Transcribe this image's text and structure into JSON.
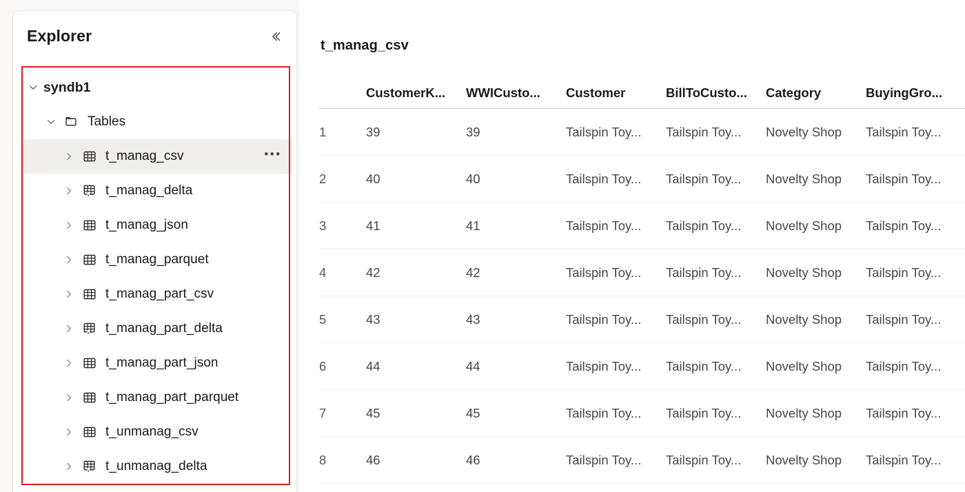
{
  "explorer": {
    "title": "Explorer",
    "collapse_icon": "chevron-double-left-icon",
    "tree": [
      {
        "label": "syndb1",
        "level": "db",
        "icon": "none",
        "twisty": "chevron-down-icon",
        "expanded": true,
        "selected": false,
        "more": false
      },
      {
        "label": "Tables",
        "level": "fold",
        "icon": "folder-icon",
        "twisty": "chevron-down-icon",
        "expanded": true,
        "selected": false,
        "more": false
      },
      {
        "label": "t_manag_csv",
        "level": "tbl",
        "icon": "table-icon",
        "twisty": "chevron-right-icon",
        "expanded": false,
        "selected": true,
        "more": true,
        "more_label": "•••"
      },
      {
        "label": "t_manag_delta",
        "level": "tbl",
        "icon": "delta-table-icon",
        "twisty": "chevron-right-icon",
        "expanded": false,
        "selected": false,
        "more": false
      },
      {
        "label": "t_manag_json",
        "level": "tbl",
        "icon": "table-icon",
        "twisty": "chevron-right-icon",
        "expanded": false,
        "selected": false,
        "more": false
      },
      {
        "label": "t_manag_parquet",
        "level": "tbl",
        "icon": "table-icon",
        "twisty": "chevron-right-icon",
        "expanded": false,
        "selected": false,
        "more": false
      },
      {
        "label": "t_manag_part_csv",
        "level": "tbl",
        "icon": "table-icon",
        "twisty": "chevron-right-icon",
        "expanded": false,
        "selected": false,
        "more": false
      },
      {
        "label": "t_manag_part_delta",
        "level": "tbl",
        "icon": "delta-table-icon",
        "twisty": "chevron-right-icon",
        "expanded": false,
        "selected": false,
        "more": false
      },
      {
        "label": "t_manag_part_json",
        "level": "tbl",
        "icon": "table-icon",
        "twisty": "chevron-right-icon",
        "expanded": false,
        "selected": false,
        "more": false
      },
      {
        "label": "t_manag_part_parquet",
        "level": "tbl",
        "icon": "table-icon",
        "twisty": "chevron-right-icon",
        "expanded": false,
        "selected": false,
        "more": false
      },
      {
        "label": "t_unmanag_csv",
        "level": "tbl",
        "icon": "table-icon",
        "twisty": "chevron-right-icon",
        "expanded": false,
        "selected": false,
        "more": false
      },
      {
        "label": "t_unmanag_delta",
        "level": "tbl",
        "icon": "delta-table-icon",
        "twisty": "chevron-right-icon",
        "expanded": false,
        "selected": false,
        "more": false
      }
    ]
  },
  "content": {
    "table_title": "t_manag_csv",
    "grid": {
      "index_header": "",
      "columns": [
        "CustomerK...",
        "WWICusto...",
        "Customer",
        "BillToCusto...",
        "Category",
        "BuyingGro..."
      ],
      "rows": [
        {
          "index": "1",
          "cells": [
            "39",
            "39",
            "Tailspin Toy...",
            "Tailspin Toy...",
            "Novelty Shop",
            "Tailspin Toy..."
          ]
        },
        {
          "index": "2",
          "cells": [
            "40",
            "40",
            "Tailspin Toy...",
            "Tailspin Toy...",
            "Novelty Shop",
            "Tailspin Toy..."
          ]
        },
        {
          "index": "3",
          "cells": [
            "41",
            "41",
            "Tailspin Toy...",
            "Tailspin Toy...",
            "Novelty Shop",
            "Tailspin Toy..."
          ]
        },
        {
          "index": "4",
          "cells": [
            "42",
            "42",
            "Tailspin Toy...",
            "Tailspin Toy...",
            "Novelty Shop",
            "Tailspin Toy..."
          ]
        },
        {
          "index": "5",
          "cells": [
            "43",
            "43",
            "Tailspin Toy...",
            "Tailspin Toy...",
            "Novelty Shop",
            "Tailspin Toy..."
          ]
        },
        {
          "index": "6",
          "cells": [
            "44",
            "44",
            "Tailspin Toy...",
            "Tailspin Toy...",
            "Novelty Shop",
            "Tailspin Toy..."
          ]
        },
        {
          "index": "7",
          "cells": [
            "45",
            "45",
            "Tailspin Toy...",
            "Tailspin Toy...",
            "Novelty Shop",
            "Tailspin Toy..."
          ]
        },
        {
          "index": "8",
          "cells": [
            "46",
            "46",
            "Tailspin Toy...",
            "Tailspin Toy...",
            "Novelty Shop",
            "Tailspin Toy..."
          ]
        }
      ]
    }
  },
  "colors": {
    "annotation": "#e01b1b",
    "panel_bg": "#ffffff",
    "page_bg": "#faf9f8",
    "selected_row": "#f0efee"
  }
}
